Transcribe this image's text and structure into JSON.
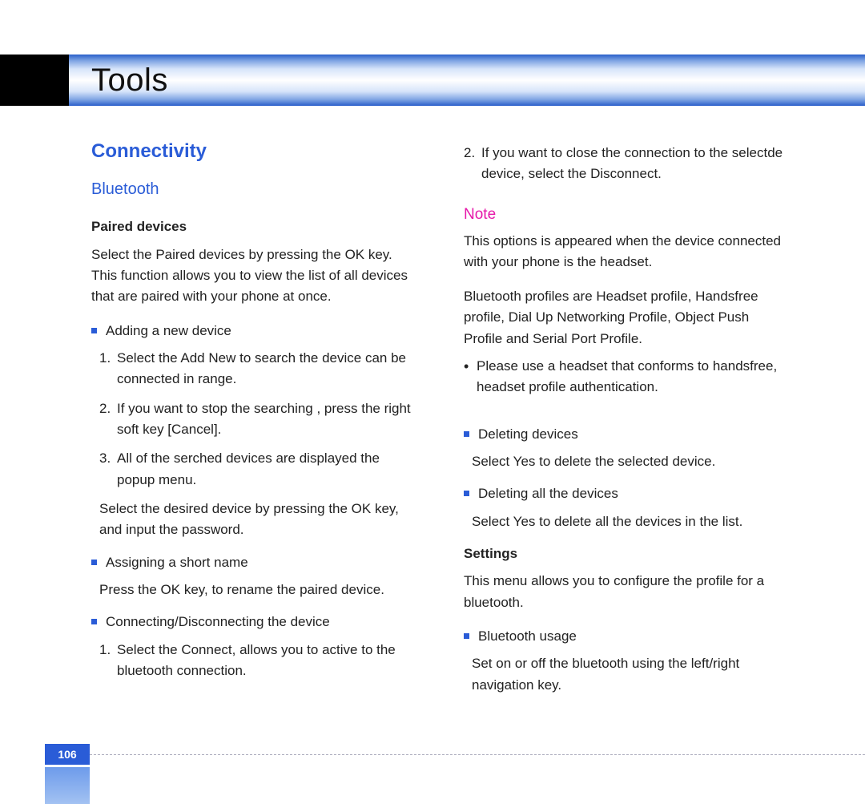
{
  "header": {
    "title": "Tools"
  },
  "page_number": "106",
  "left": {
    "section": "Connectivity",
    "subsection": "Bluetooth",
    "paired_heading": "Paired devices",
    "paired_intro": "Select the Paired devices by pressing the OK key. This function allows you to view the list of all devices  that are paired with your phone at once.",
    "add_label": "Adding a new device",
    "add_steps": [
      "Select the Add New to search the device can be connected in range.",
      "If you want to stop the searching , press the right soft key [Cancel].",
      "All of the serched devices are displayed the popup menu."
    ],
    "add_after": "Select the desired device by pressing the OK key, and input the password.",
    "assign_label": "Assigning a short name",
    "assign_text": "Press the OK key, to rename the paired device.",
    "connect_label": "Connecting/Disconnecting the device",
    "connect_steps": [
      "Select the Connect, allows you to active to the bluetooth connection."
    ]
  },
  "right": {
    "connect_step2": "If you want to close the connection to the selectde device, select the Disconnect.",
    "note_label": "Note",
    "note_para1": "This options is appeared when the device connected with your phone is the headset.",
    "note_para2": "Bluetooth profiles are Headset profile, Handsfree profile, Dial Up Networking Profile, Object Push Profile and Serial Port Profile.",
    "note_bullet": "Please use a headset that conforms to handsfree, headset profile authentication.",
    "delete_label": "Deleting devices",
    "delete_text": "Select Yes to delete the selected device.",
    "delete_all_label": "Deleting all the devices",
    "delete_all_text": "Select Yes to delete all the devices in the list.",
    "settings_heading": "Settings",
    "settings_intro": "This menu allows you to configure the profile for a bluetooth.",
    "bt_usage_label": "Bluetooth usage",
    "bt_usage_text": "Set on or off the bluetooth using the left/right navigation key."
  }
}
